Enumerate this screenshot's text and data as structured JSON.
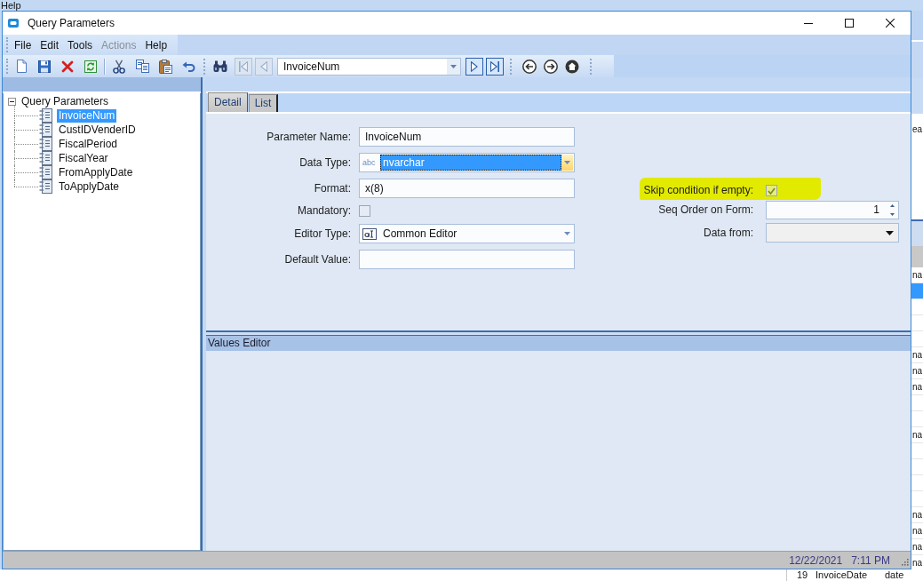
{
  "background_app": {
    "menu": [
      {
        "label": "Help"
      }
    ],
    "side_label": "ea",
    "rows": [
      {
        "text": "na",
        "selected": false
      },
      {
        "selected": true
      },
      {
        "selected": false
      },
      {
        "selected": false
      },
      {
        "selected": false
      },
      {
        "text": "na",
        "selected": false
      },
      {
        "text": "na",
        "selected": false
      },
      {
        "text": "na",
        "selected": false
      },
      {
        "selected": false
      },
      {
        "selected": false
      },
      {
        "text": "na",
        "selected": false
      },
      {
        "selected": false
      },
      {
        "selected": false
      },
      {
        "selected": false
      },
      {
        "selected": false
      },
      {
        "text": "na",
        "selected": false
      },
      {
        "text": "na",
        "selected": false
      },
      {
        "text": "na",
        "selected": false
      },
      {
        "text": "na",
        "selected": false
      }
    ],
    "bottom_row": [
      "19",
      "InvoiceDate",
      "date"
    ]
  },
  "window": {
    "title": "Query Parameters"
  },
  "menu": [
    {
      "label": "File",
      "disabled": false
    },
    {
      "label": "Edit",
      "disabled": false
    },
    {
      "label": "Tools",
      "disabled": false
    },
    {
      "label": "Actions",
      "disabled": true
    },
    {
      "label": "Help",
      "disabled": false
    }
  ],
  "toolbar": {
    "navigation": [
      {
        "kind": "first",
        "disabled": true
      },
      {
        "kind": "previous",
        "disabled": true
      },
      {
        "kind": "next",
        "disabled": false
      },
      {
        "kind": "last",
        "disabled": false
      }
    ],
    "record_combo": {
      "value": "InvoiceNum"
    }
  },
  "tree": {
    "label": "Query Parameters",
    "expanded": true,
    "children": [
      {
        "label": "InvoiceNum",
        "selected": true
      },
      {
        "label": "CustIDVenderID",
        "selected": false
      },
      {
        "label": "FiscalPeriod",
        "selected": false
      },
      {
        "label": "FiscalYear",
        "selected": false
      },
      {
        "label": "FromApplyDate",
        "selected": false
      },
      {
        "label": "ToApplyDate",
        "selected": false
      }
    ]
  },
  "tabs": [
    {
      "label": "Detail",
      "selected": true
    },
    {
      "label": "List",
      "selected": false
    }
  ],
  "form": {
    "left_fields": [
      {
        "kind": "textbox",
        "label": "Parameter Name:",
        "value": "InvoiceNum"
      },
      {
        "kind": "typecombo",
        "label": "Data Type:",
        "type_icon": "abc",
        "value": "nvarchar",
        "value_selected": true,
        "hovered": true
      },
      {
        "kind": "textbox",
        "label": "Format:",
        "value": "x(8)"
      },
      {
        "kind": "checkbox",
        "label": "Mandatory:",
        "checked": false,
        "highlighted": false
      },
      {
        "kind": "iconcombo",
        "label": "Editor Type:",
        "value": "Common Editor",
        "value_selected": false,
        "hovered": false
      },
      {
        "kind": "textbox",
        "label": "Default Value:"
      }
    ],
    "right_fields": [
      {
        "kind": "checkbox",
        "label": "Skip condition if empty:",
        "checked": true,
        "highlighted": true
      },
      {
        "kind": "spinner",
        "label": "Seq Order on Form:",
        "value": "1"
      },
      {
        "kind": "dropdown",
        "label": "Data from:"
      }
    ]
  },
  "values_editor": {
    "title": "Values Editor"
  },
  "status_bar": {
    "date": "12/22/2021",
    "time": "7:11 PM"
  }
}
